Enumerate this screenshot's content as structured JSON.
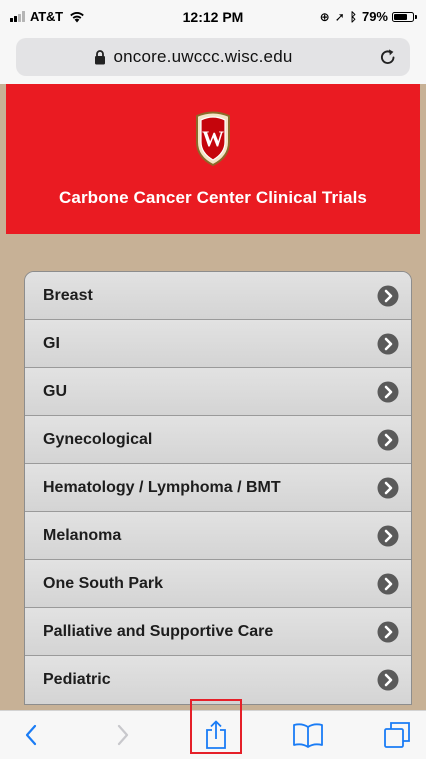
{
  "status_bar": {
    "carrier": "AT&T",
    "time": "12:12 PM",
    "battery_percent": "79%",
    "battery_level": 0.79
  },
  "address_bar": {
    "url": "oncore.uwccc.wisc.edu"
  },
  "header": {
    "title": "Carbone Cancer Center Clinical Trials",
    "crest_letter": "W"
  },
  "trials": {
    "items": [
      {
        "label": "Breast"
      },
      {
        "label": "GI"
      },
      {
        "label": "GU"
      },
      {
        "label": "Gynecological"
      },
      {
        "label": "Hematology / Lymphoma / BMT"
      },
      {
        "label": "Melanoma"
      },
      {
        "label": "One South Park"
      },
      {
        "label": "Palliative and Supportive Care"
      },
      {
        "label": "Pediatric"
      }
    ]
  },
  "toolbar": {
    "icons": [
      "back-icon",
      "forward-icon",
      "share-icon",
      "bookmarks-icon",
      "tabs-icon"
    ]
  },
  "colors": {
    "header_red": "#ea1b22",
    "body_tan": "#c7b196",
    "ios_blue": "#1a7cf5",
    "highlight_red": "#e52029"
  }
}
